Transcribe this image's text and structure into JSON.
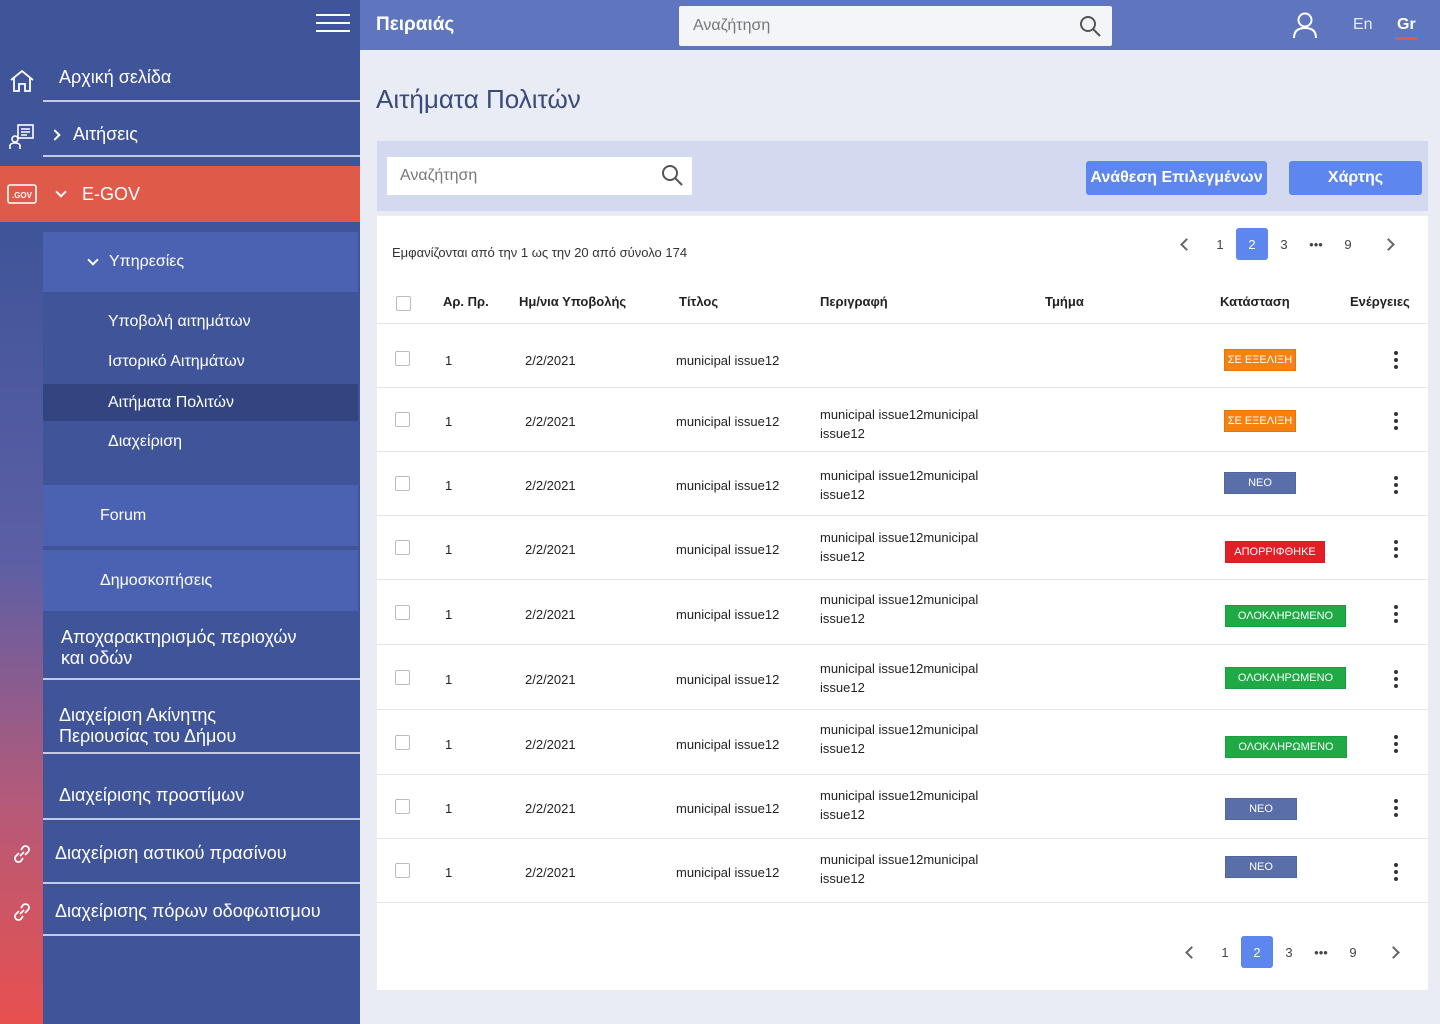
{
  "app": {
    "brand": "Πειραιάς",
    "search_placeholder": "Αναζήτηση",
    "lang_en": "En",
    "lang_gr": "Gr"
  },
  "sidebar": {
    "home": "Αρχική σελίδα",
    "requests": "Αιτήσεις",
    "egov": "E-GOV",
    "services": "Υπηρεσίες",
    "leaf_items": [
      "Υποβολή αιτημάτων",
      "Ιστορικό Αιτημάτων",
      "Αιτήματα Πολιτών",
      "Διαχείριση"
    ],
    "forum": "Forum",
    "polls": "Δημοσκοπήσεις",
    "declass_line1": "Αποχαρακτηρισμός περιοχών",
    "declass_line2": "και οδών",
    "property_line1": "Διαχείριση Ακίνητης",
    "property_line2": "Περιουσίας του Δήμου",
    "fines": "Διαχείρισης προστίμων",
    "green": "Διαχείριση αστικού πρασίνου",
    "lighting": "Διαχείρισης πόρων οδοφωτισμου"
  },
  "main": {
    "title": "Αιτήματα Πολιτών",
    "search_placeholder": "Αναζήτηση",
    "assign_button": "Ανάθεση Επιλεγμένων",
    "map_button": "Χάρτης",
    "summary": "Εμφανίζονται από την 1 ως την 20 από σύνολο 174",
    "pages": [
      "1",
      "2",
      "3",
      "•••",
      "9"
    ],
    "current_page": "2"
  },
  "table": {
    "headers": [
      "Αρ. Πρ.",
      "Ημ/νια Υποβολής",
      "Τίτλος",
      "Περιγραφή",
      "Τμήμα",
      "Κατάσταση",
      "Ενέργειες"
    ],
    "rows": [
      {
        "num": "1",
        "date": "2/2/2021",
        "title": "municipal issue12",
        "desc": "",
        "dept": "",
        "status": "ΣΕ ΕΞΕΛΙΞΗ"
      },
      {
        "num": "1",
        "date": "2/2/2021",
        "title": "municipal issue12",
        "desc": "municipal issue12municipal issue12",
        "dept": "",
        "status": "ΣΕ ΕΞΕΛΙΞΗ"
      },
      {
        "num": "1",
        "date": "2/2/2021",
        "title": "municipal issue12",
        "desc": "municipal issue12municipal issue12",
        "dept": "",
        "status": "ΝΕΟ"
      },
      {
        "num": "1",
        "date": "2/2/2021",
        "title": "municipal issue12",
        "desc": "municipal issue12municipal issue12",
        "dept": "",
        "status": "ΑΠΟΡΡΙΦΘΗΚΕ"
      },
      {
        "num": "1",
        "date": "2/2/2021",
        "title": "municipal issue12",
        "desc": "municipal issue12municipal issue12",
        "dept": "",
        "status": "ΟΛΟΚΛΗΡΩΜΕΝΟ"
      },
      {
        "num": "1",
        "date": "2/2/2021",
        "title": "municipal issue12",
        "desc": "municipal issue12municipal issue12",
        "dept": "",
        "status": "ΟΛΟΚΛΗΡΩΜΕΝΟ"
      },
      {
        "num": "1",
        "date": "2/2/2021",
        "title": "municipal issue12",
        "desc": "municipal issue12municipal issue12",
        "dept": "",
        "status": "ΟΛΟΚΛΗΡΩΜΕΝΟ"
      },
      {
        "num": "1",
        "date": "2/2/2021",
        "title": "municipal issue12",
        "desc": "municipal issue12municipal issue12",
        "dept": "",
        "status": "ΝΕΟ"
      },
      {
        "num": "1",
        "date": "2/2/2021",
        "title": "municipal issue12",
        "desc": "municipal issue12municipal issue12",
        "dept": "",
        "status": "ΝΕΟ"
      }
    ]
  },
  "colors": {
    "status_in_progress": "#f5810f",
    "status_new": "#5a6fa9",
    "status_rejected": "#e21f26",
    "status_completed": "#1faa46",
    "accent": "#5d86ef",
    "egov_active": "#e05a4a"
  }
}
